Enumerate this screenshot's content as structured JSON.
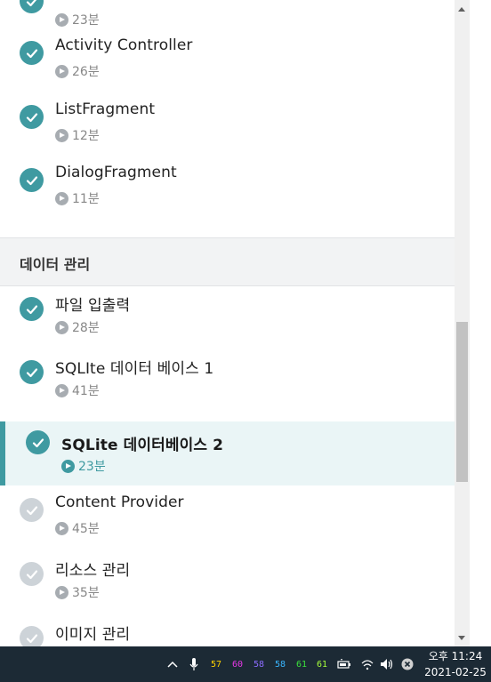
{
  "lessons_top": [
    {
      "title": "",
      "duration": "23분",
      "status": "done"
    },
    {
      "title": "Activity Controller",
      "duration": "26분",
      "status": "done"
    },
    {
      "title": "ListFragment",
      "duration": "12분",
      "status": "done"
    },
    {
      "title": "DialogFragment",
      "duration": "11분",
      "status": "done"
    }
  ],
  "section": {
    "title": "데이터 관리"
  },
  "lessons_section": [
    {
      "title": "파일 입출력",
      "duration": "28분",
      "status": "done"
    },
    {
      "title": "SQLIte 데이터 베이스 1",
      "duration": "41분",
      "status": "done"
    },
    {
      "title": "SQLite 데이터베이스 2",
      "duration": "23분",
      "status": "active"
    },
    {
      "title": "Content Provider",
      "duration": "45분",
      "status": "pending"
    },
    {
      "title": "리소스 관리",
      "duration": "35분",
      "status": "pending"
    },
    {
      "title": "이미지 관리",
      "duration": "",
      "status": "pending"
    }
  ],
  "colors": {
    "accent": "#3f9aa1",
    "pending": "#cdd3d8",
    "active_bg": "#eaf5f6",
    "section_bg": "#f2f3f4",
    "taskbar_bg": "#1c2a35"
  },
  "taskbar": {
    "icons": [
      "chevron-up-icon",
      "microphone-icon",
      "wifi-icon",
      "battery-icon",
      "speaker-icon",
      "close-icon"
    ],
    "tray_numbers": [
      {
        "value": "57",
        "color": "#ffd400"
      },
      {
        "value": "60",
        "color": "#e838e8"
      },
      {
        "value": "58",
        "color": "#8c6cff"
      },
      {
        "value": "58",
        "color": "#39b6ff"
      },
      {
        "value": "61",
        "color": "#3be03b"
      },
      {
        "value": "61",
        "color": "#a6ff3a"
      }
    ],
    "clock_time": "오후 11:24",
    "clock_date": "2021-02-25"
  }
}
